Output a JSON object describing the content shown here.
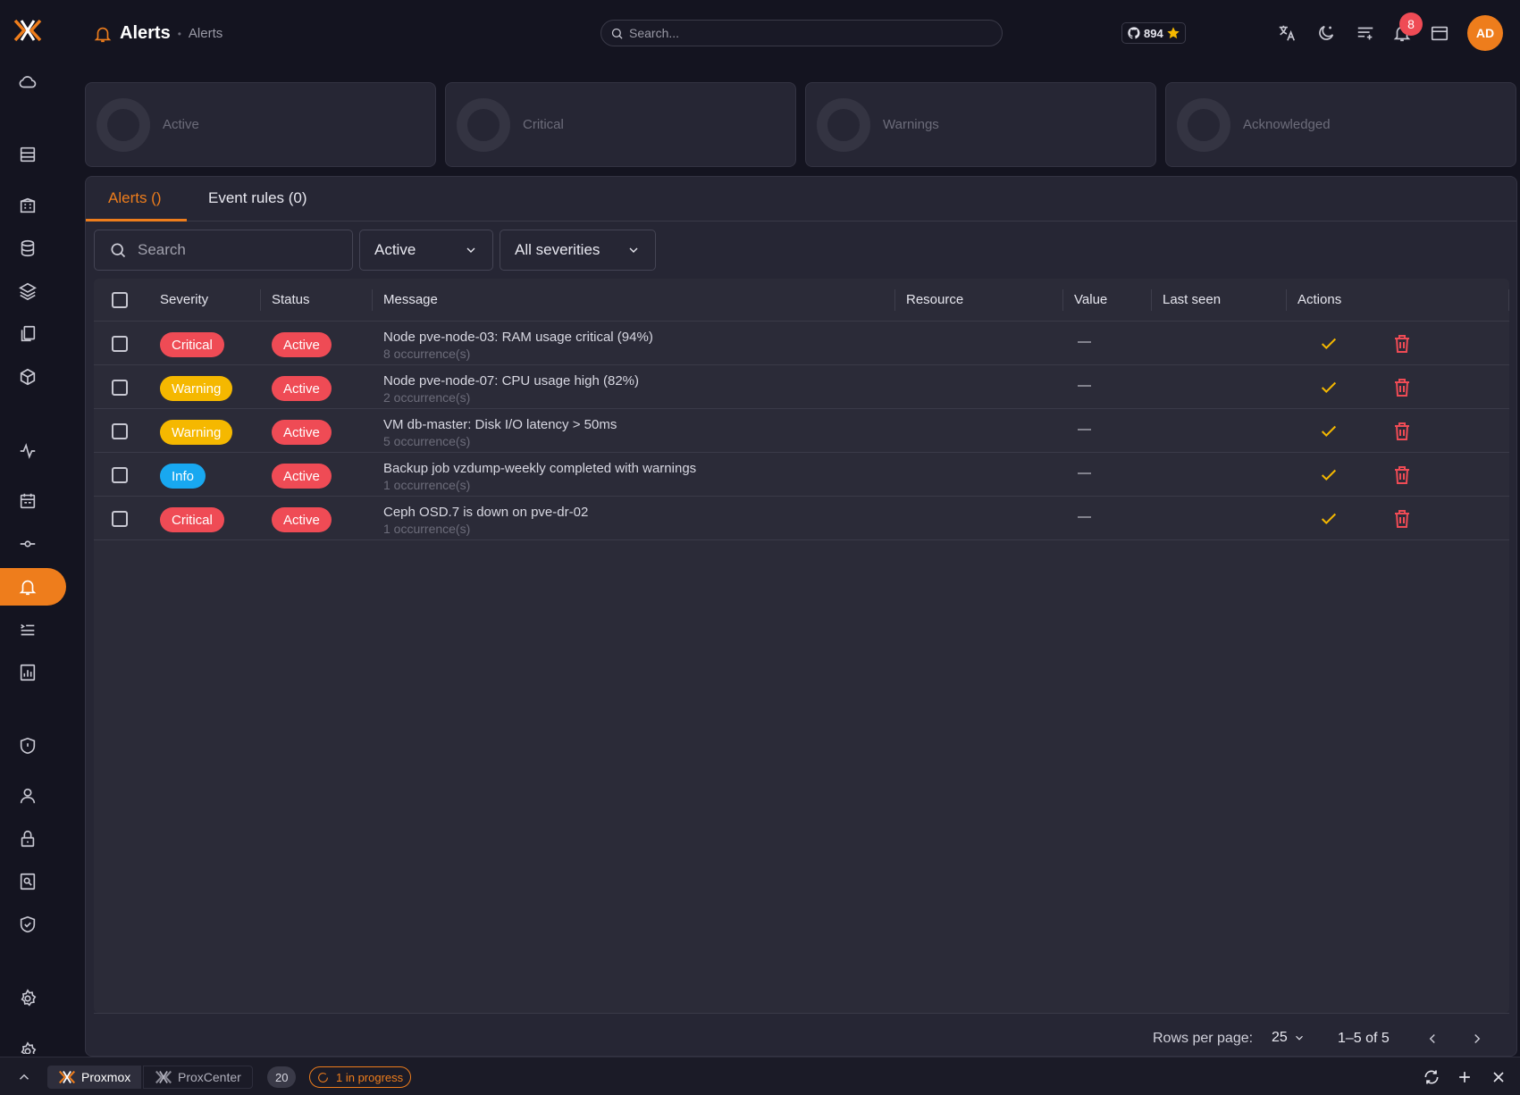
{
  "header": {
    "title": "Alerts",
    "breadcrumb_sub": "Alerts",
    "search_placeholder": "Search...",
    "github_stars": "894",
    "notification_count": "8",
    "avatar_initials": "AD"
  },
  "colors": {
    "accent": "#ee7d1c",
    "critical": "#ef4b55",
    "warning": "#f5b800",
    "info": "#18a8f0"
  },
  "stat_cards": [
    {
      "label": "Active"
    },
    {
      "label": "Critical"
    },
    {
      "label": "Warnings"
    },
    {
      "label": "Acknowledged"
    }
  ],
  "tabs": [
    {
      "label": "Alerts ()"
    },
    {
      "label": "Event rules (0)"
    }
  ],
  "filters": {
    "search_placeholder": "Search",
    "status_value": "Active",
    "severity_value": "All severities"
  },
  "table": {
    "columns": [
      "Severity",
      "Status",
      "Message",
      "Resource",
      "Value",
      "Last seen",
      "Actions"
    ],
    "rows": [
      {
        "severity": "Critical",
        "status": "Active",
        "message": "Node pve-node-03: RAM usage critical (94%)",
        "occurrences": "8 occurrence(s)",
        "value": "—"
      },
      {
        "severity": "Warning",
        "status": "Active",
        "message": "Node pve-node-07: CPU usage high (82%)",
        "occurrences": "2 occurrence(s)",
        "value": "—"
      },
      {
        "severity": "Warning",
        "status": "Active",
        "message": "VM db-master: Disk I/O latency > 50ms",
        "occurrences": "5 occurrence(s)",
        "value": "—"
      },
      {
        "severity": "Info",
        "status": "Active",
        "message": "Backup job vzdump-weekly completed with warnings",
        "occurrences": "1 occurrence(s)",
        "value": "—"
      },
      {
        "severity": "Critical",
        "status": "Active",
        "message": "Ceph OSD.7 is down on pve-dr-02",
        "occurrences": "1 occurrence(s)",
        "value": "—"
      }
    ]
  },
  "pagination": {
    "rows_per_page_label": "Rows per page:",
    "rows_per_page": "25",
    "range": "1–5 of 5"
  },
  "bottombar": {
    "tabs": [
      {
        "label": "Proxmox"
      },
      {
        "label": "ProxCenter"
      }
    ],
    "count": "20",
    "progress": "1 in progress"
  }
}
